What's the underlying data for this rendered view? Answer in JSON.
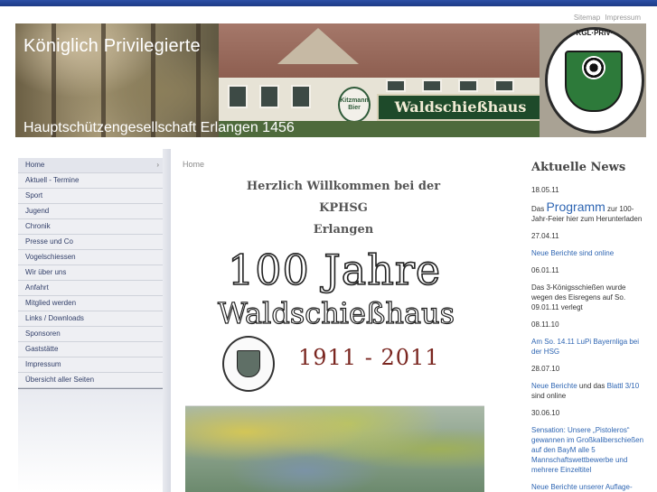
{
  "toplinks": {
    "sitemap": "Sitemap",
    "impressum": "Impressum"
  },
  "header": {
    "title_line1": "Königlich Privilegierte",
    "title_line2": "Hauptschützengesellschaft Erlangen 1456",
    "sign_text": "Waldschießhaus",
    "beer_sign": "Kitzmann Bier",
    "emblem_text": "KGL·PRIV·"
  },
  "nav": {
    "items": [
      {
        "label": "Home",
        "active": true
      },
      {
        "label": "Aktuell - Termine"
      },
      {
        "label": "Sport"
      },
      {
        "label": "Jugend"
      },
      {
        "label": "Chronik"
      },
      {
        "label": "Presse und Co"
      },
      {
        "label": "Vogelschiessen"
      },
      {
        "label": "Wir über uns"
      },
      {
        "label": "Anfahrt"
      },
      {
        "label": "Mitglied werden"
      },
      {
        "label": "Links / Downloads"
      },
      {
        "label": "Sponsoren"
      },
      {
        "label": "Gaststätte"
      },
      {
        "label": "Impressum"
      },
      {
        "label": "Übersicht aller Seiten"
      }
    ],
    "chevron": "›"
  },
  "main": {
    "breadcrumb": "Home",
    "welcome_line1": "Herzlich Willkommen bei der KPHSG",
    "welcome_line2": "Erlangen",
    "poster_line1": "100 Jahre",
    "poster_line2": "Waldschießhaus",
    "poster_years": "1911 - 2011"
  },
  "news": {
    "title": "Aktuelle News",
    "entries": [
      {
        "date": "18.05.11"
      },
      {
        "pre": "Das ",
        "link": "Programm",
        "post": " zur 100-Jahr-Feier hier zum Herunterladen"
      },
      {
        "date": "27.04.11"
      },
      {
        "link": "Neue Berichte sind online"
      },
      {
        "date": "06.01.11"
      },
      {
        "text": "Das 3-Königsschießen wurde wegen des Eisregens auf So. 09.01.11 verlegt"
      },
      {
        "date": "08.11.10"
      },
      {
        "link": "Am So. 14.11 LuPi Bayernliga bei der HSG"
      },
      {
        "date": "28.07.10"
      },
      {
        "link": "Neue Berichte",
        "mid": " und das ",
        "link2": "Blattl 3/10",
        "post": " sind online"
      },
      {
        "date": "30.06.10"
      },
      {
        "link": "Sensation: Unsere „Pistoleros“ gewannen im Großkaliberschießen auf den BayM alle 5 Mannschaftswettbewerbe und mehrere Einzeltitel"
      },
      {
        "link": "Neue Berichte unserer Auflage-Schützen"
      }
    ]
  }
}
